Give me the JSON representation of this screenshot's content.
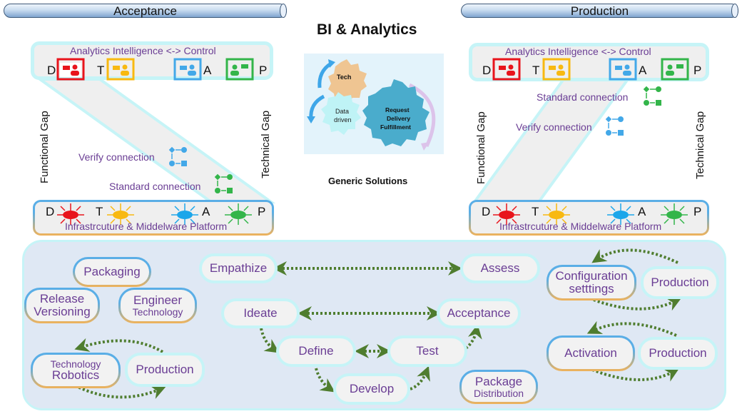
{
  "banners": {
    "left": "Acceptance",
    "right": "Production"
  },
  "title": "BI & Analytics",
  "subtitle": "Generic Solutions",
  "gears": {
    "tech": "Tech",
    "data_driven": [
      "Data",
      "driven"
    ],
    "request": [
      "Request",
      "Delivery",
      "Fulfillment"
    ]
  },
  "colors": {
    "D": "#e8141c",
    "T": "#f8b911",
    "A": "#43a8e8",
    "P": "#33b54a",
    "label_purple": "#6a3d94",
    "arrow_green": "#4f7d2f"
  },
  "environments": [
    {
      "id": "acceptance",
      "control_title": "Analytics Intelligence <-> Control",
      "letters": [
        "D",
        "T",
        "A",
        "P"
      ],
      "platform_title": "Infrastrcuture & Middelware Platform",
      "functional_gap": "Functional Gap",
      "technical_gap": "Technical Gap",
      "verify_connection": "Verify connection",
      "standard_connection": "Standard connection"
    },
    {
      "id": "production",
      "control_title": "Analytics Intelligence <-> Control",
      "letters": [
        "D",
        "T",
        "A",
        "P"
      ],
      "platform_title": "Infrastrcuture & Middelware Platform",
      "functional_gap": "Functional Gap",
      "technical_gap": "Technical Gap",
      "verify_connection": "Verify connection",
      "standard_connection": "Standard connection"
    }
  ],
  "process": {
    "packaging": "Packaging",
    "release": [
      "Release",
      "Versioning"
    ],
    "engineer": [
      "Engineer",
      "Technology"
    ],
    "tech_robotics": [
      "Technology",
      "Robotics"
    ],
    "production_left": "Production",
    "empathize": "Empathize",
    "assess": "Assess",
    "ideate": "Ideate",
    "acceptance": "Acceptance",
    "define": "Define",
    "test": "Test",
    "develop": "Develop",
    "package_distribution": [
      "Package",
      "Distribution"
    ],
    "configuration": [
      "Configuration",
      "setttings"
    ],
    "production_right_top": "Production",
    "activation": "Activation",
    "production_right_bottom": "Production"
  }
}
